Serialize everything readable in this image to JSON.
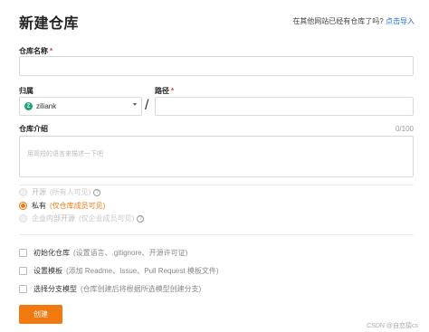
{
  "header": {
    "title": "新建仓库",
    "import_hint": "在其他网站已经有仓库了吗?",
    "import_link": "点击导入"
  },
  "repo_name": {
    "label": "仓库名称",
    "required_mark": "*",
    "value": ""
  },
  "owner": {
    "label": "归属",
    "avatar_letter": "Z",
    "avatar_color": "#1aa37a",
    "selected_value": "ziliank"
  },
  "path_separator": "/",
  "path": {
    "label": "路径",
    "required_mark": "*",
    "value": ""
  },
  "description": {
    "label": "仓库介绍",
    "counter": "0/100",
    "placeholder": "用简短的语言来描述一下吧"
  },
  "visibility": {
    "options": [
      {
        "label": "开源",
        "desc": "(所有人可见)",
        "state": "disabled",
        "help_icon": "?"
      },
      {
        "label": "私有",
        "desc": "(仅仓库成员可见)",
        "state": "checked"
      },
      {
        "label": "企业内部开源",
        "desc": "(仅企业成员可见)",
        "state": "disabled",
        "help_icon": "?"
      }
    ]
  },
  "options": [
    {
      "label": "初始化仓库",
      "desc": "(设置语言、.gitignore、开源许可证)",
      "checked": false
    },
    {
      "label": "设置模板",
      "desc": "(添加 Readme、Issue、Pull Request 模板文件)",
      "checked": false
    },
    {
      "label": "选择分支模型",
      "desc": "(仓库创建后将根据所选模型创建分支)",
      "checked": false
    }
  ],
  "create_button": "创建",
  "watermark": "CSDN @自恋猿cs",
  "colors": {
    "accent": "#f07a0f",
    "link": "#1f6fd6",
    "required": "#ee3333"
  }
}
